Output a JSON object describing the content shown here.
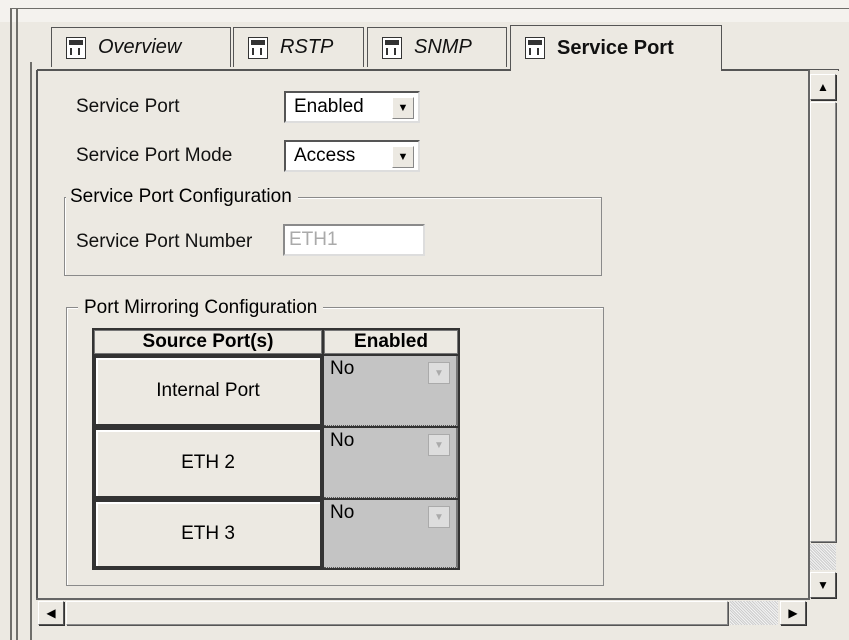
{
  "tabs": [
    {
      "label": "Overview",
      "icon": "module-icon"
    },
    {
      "label": "RSTP",
      "icon": "module-icon"
    },
    {
      "label": "SNMP",
      "icon": "module-icon"
    },
    {
      "label": "Service Port",
      "icon": "module-icon",
      "active": true
    }
  ],
  "service_port": {
    "label": "Service Port",
    "value": "Enabled"
  },
  "service_port_mode": {
    "label": "Service Port Mode",
    "value": "Access"
  },
  "config_group": {
    "title": "Service Port Configuration",
    "number_label": "Service Port Number",
    "number_value": "ETH1"
  },
  "mirroring_group": {
    "title": "Port Mirroring Configuration",
    "headers": [
      "Source Port(s)",
      "Enabled"
    ],
    "rows": [
      {
        "port": "Internal Port",
        "enabled": "No"
      },
      {
        "port": "ETH 2",
        "enabled": "No"
      },
      {
        "port": "ETH 3",
        "enabled": "No"
      }
    ]
  }
}
